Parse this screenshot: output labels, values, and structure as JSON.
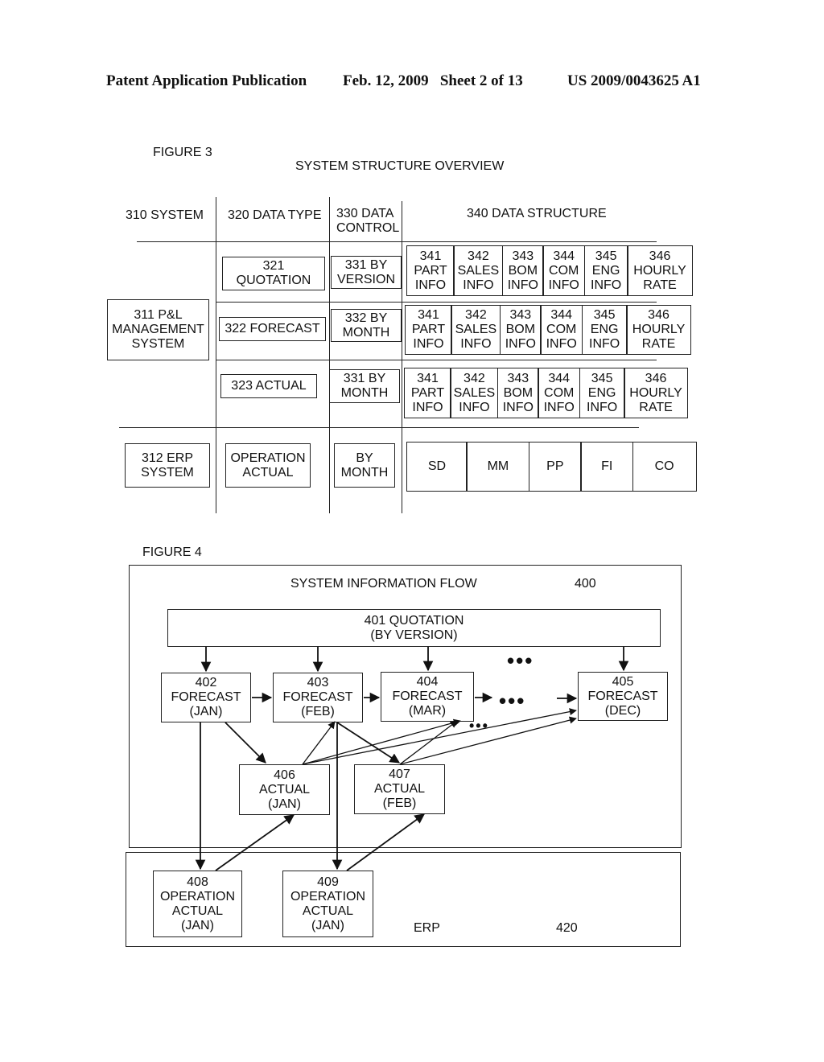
{
  "header": {
    "publication": "Patent Application Publication",
    "date_sheet": "Feb. 12, 2009   Sheet 2 of 13",
    "patent_number": "US 2009/0043625 A1"
  },
  "figure3": {
    "label": "FIGURE 3",
    "title": "SYSTEM STRUCTURE OVERVIEW",
    "columns": [
      "310 SYSTEM",
      "320 DATA TYPE",
      "330 DATA\nCONTROL",
      "340 DATA STRUCTURE"
    ],
    "systems": [
      "311 P&L\nMANAGEMENT\nSYSTEM",
      "312 ERP\nSYSTEM"
    ],
    "data_types": [
      "321\nQUOTATION",
      "322 FORECAST",
      "323 ACTUAL",
      "OPERATION\nACTUAL"
    ],
    "data_controls": [
      "331 BY\nVERSION",
      "332 BY\nMONTH",
      "331 BY\nMONTH",
      "BY\nMONTH"
    ],
    "structure_rows": [
      [
        "341\nPART\nINFO",
        "342\nSALES\nINFO",
        "343\nBOM\nINFO",
        "344\nCOM\nINFO",
        "345\nENG\nINFO",
        "346\nHOURLY\nRATE"
      ],
      [
        "341\nPART\nINFO",
        "342\nSALES\nINFO",
        "343\nBOM\nINFO",
        "344\nCOM\nINFO",
        "345\nENG\nINFO",
        "346\nHOURLY\nRATE"
      ],
      [
        "341\nPART\nINFO",
        "342\nSALES\nINFO",
        "343\nBOM\nINFO",
        "344\nCOM\nINFO",
        "345\nENG\nINFO",
        "346\nHOURLY\nRATE"
      ]
    ],
    "erp_modules": [
      "SD",
      "MM",
      "PP",
      "FI",
      "CO"
    ]
  },
  "figure4": {
    "label": "FIGURE 4",
    "title": "SYSTEM INFORMATION FLOW",
    "ref": "400",
    "quotation": "401 QUOTATION\n(BY VERSION)",
    "forecasts": [
      "402\nFORECAST\n(JAN)",
      "403\nFORECAST\n(FEB)",
      "404\nFORECAST\n(MAR)",
      "405\nFORECAST\n(DEC)"
    ],
    "actuals": [
      "406\nACTUAL\n(JAN)",
      "407\nACTUAL\n(FEB)"
    ],
    "operation_actuals": [
      "408\nOPERATION\nACTUAL\n(JAN)",
      "409\nOPERATION\nACTUAL\n(JAN)"
    ],
    "erp_label": "ERP",
    "erp_ref": "420",
    "ellipsis": "•••"
  }
}
